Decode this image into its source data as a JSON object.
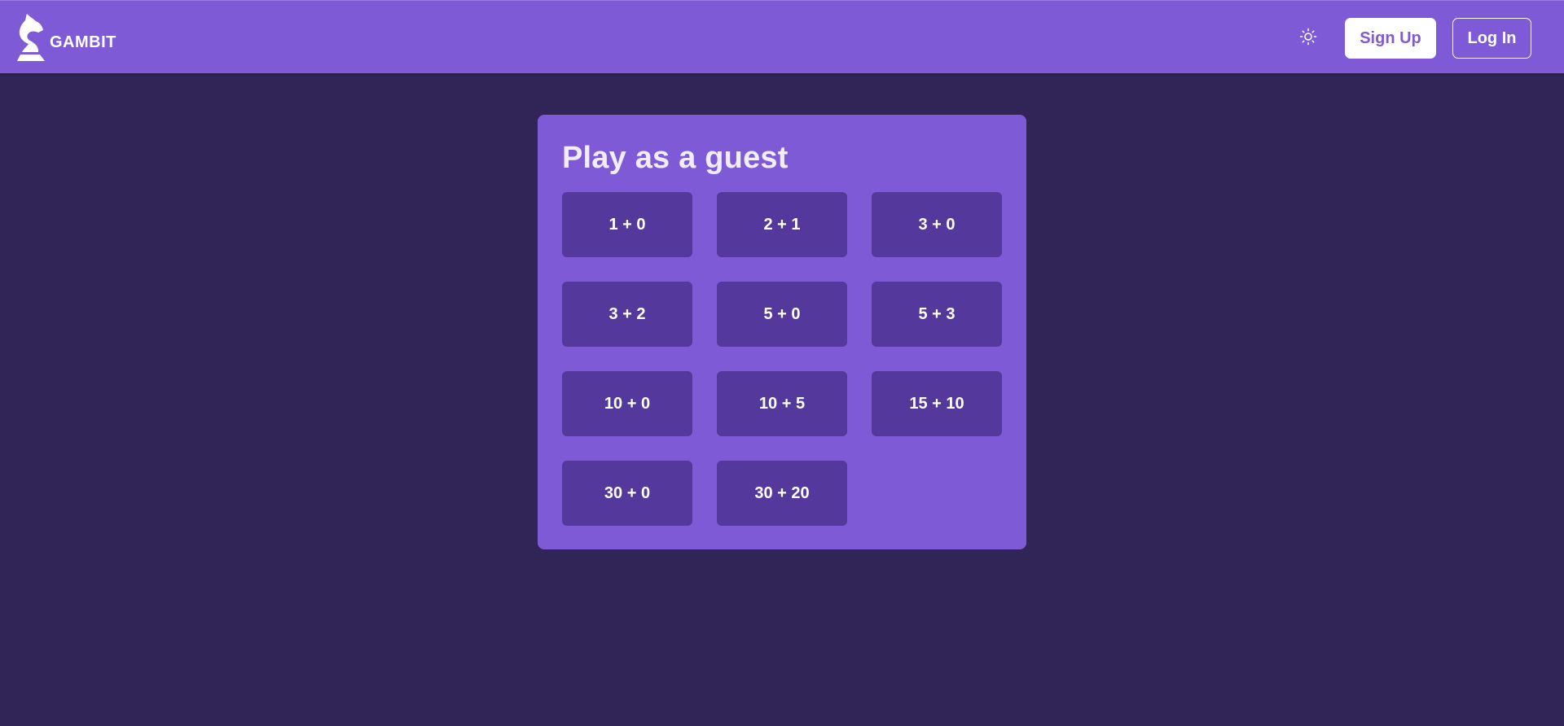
{
  "navbar": {
    "brand": "GAMBIT",
    "logo_icon": "knight-icon",
    "theme_icon": "sun-icon",
    "signup_label": "Sign Up",
    "login_label": "Log In"
  },
  "guest": {
    "title": "Play as a guest",
    "time_controls": [
      "1 + 0",
      "2 + 1",
      "3 + 0",
      "3 + 2",
      "5 + 0",
      "5 + 3",
      "10 + 0",
      "10 + 5",
      "15 + 10",
      "30 + 0",
      "30 + 20"
    ]
  },
  "colors": {
    "background": "#312557",
    "primary": "#7f5ad6",
    "button": "#55389c",
    "text": "#ffffff"
  }
}
